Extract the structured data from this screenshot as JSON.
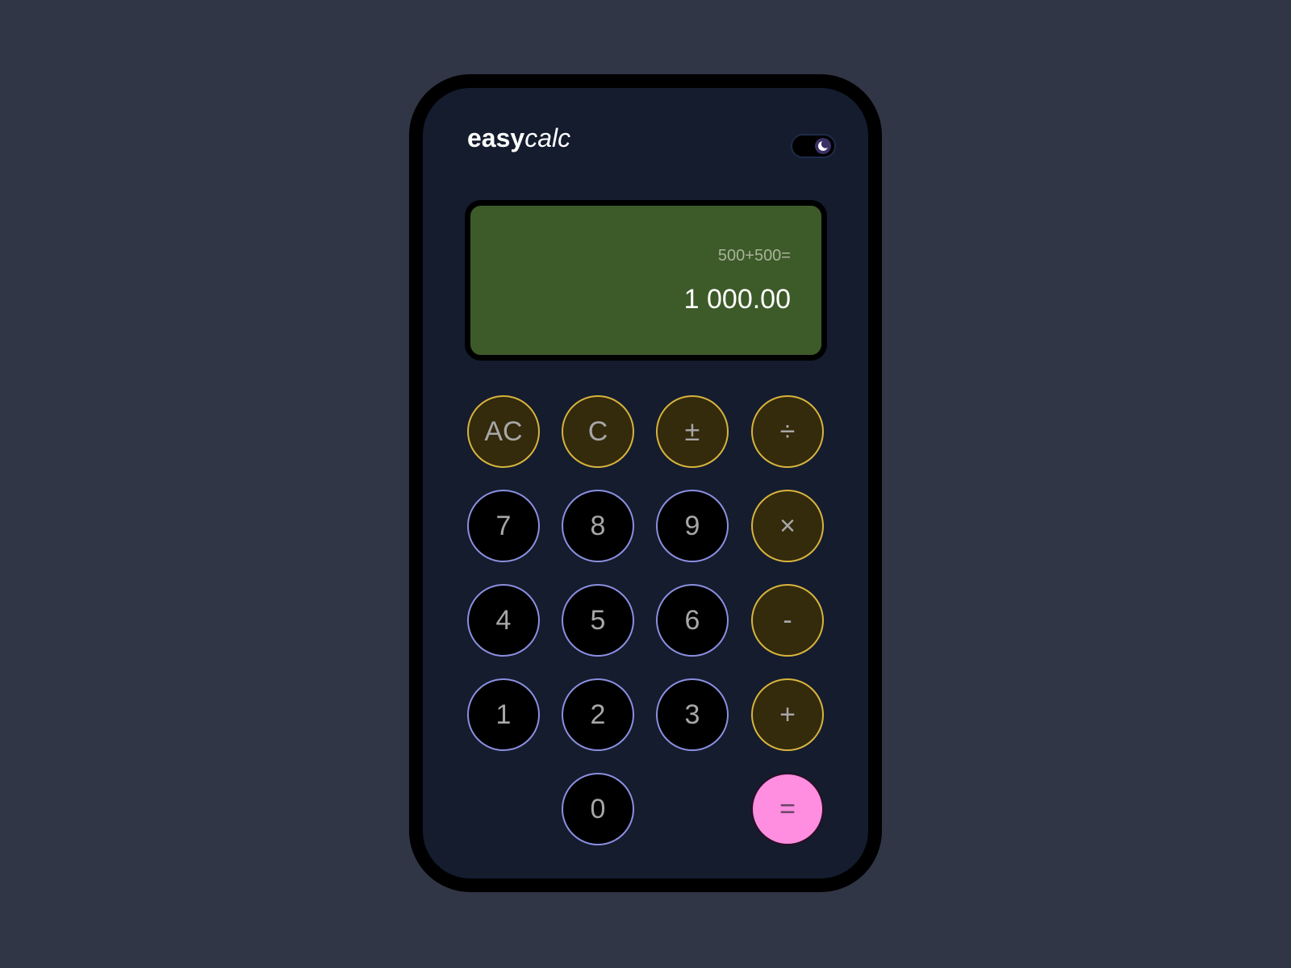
{
  "app": {
    "brand_bold": "easy",
    "brand_light": "calc"
  },
  "theme_toggle": {
    "icon": "moon-icon",
    "state": "dark"
  },
  "display": {
    "expression": "500+500=",
    "result": "1 000.00"
  },
  "keys": {
    "ac": "AC",
    "c": "C",
    "sign": "±",
    "divide": "÷",
    "seven": "7",
    "eight": "8",
    "nine": "9",
    "multiply": "×",
    "four": "4",
    "five": "5",
    "six": "6",
    "minus": "-",
    "one": "1",
    "two": "2",
    "three": "3",
    "plus": "+",
    "zero": "0",
    "equals": "="
  },
  "colors": {
    "page_background": "#313646",
    "device_background": "#141c2e",
    "display_background": "#3d5a29",
    "number_key_border": "#8b8fe0",
    "operator_key_fill": "#342a0c",
    "operator_key_border": "#d8b43d",
    "equals_key_fill": "#ff8de0"
  }
}
